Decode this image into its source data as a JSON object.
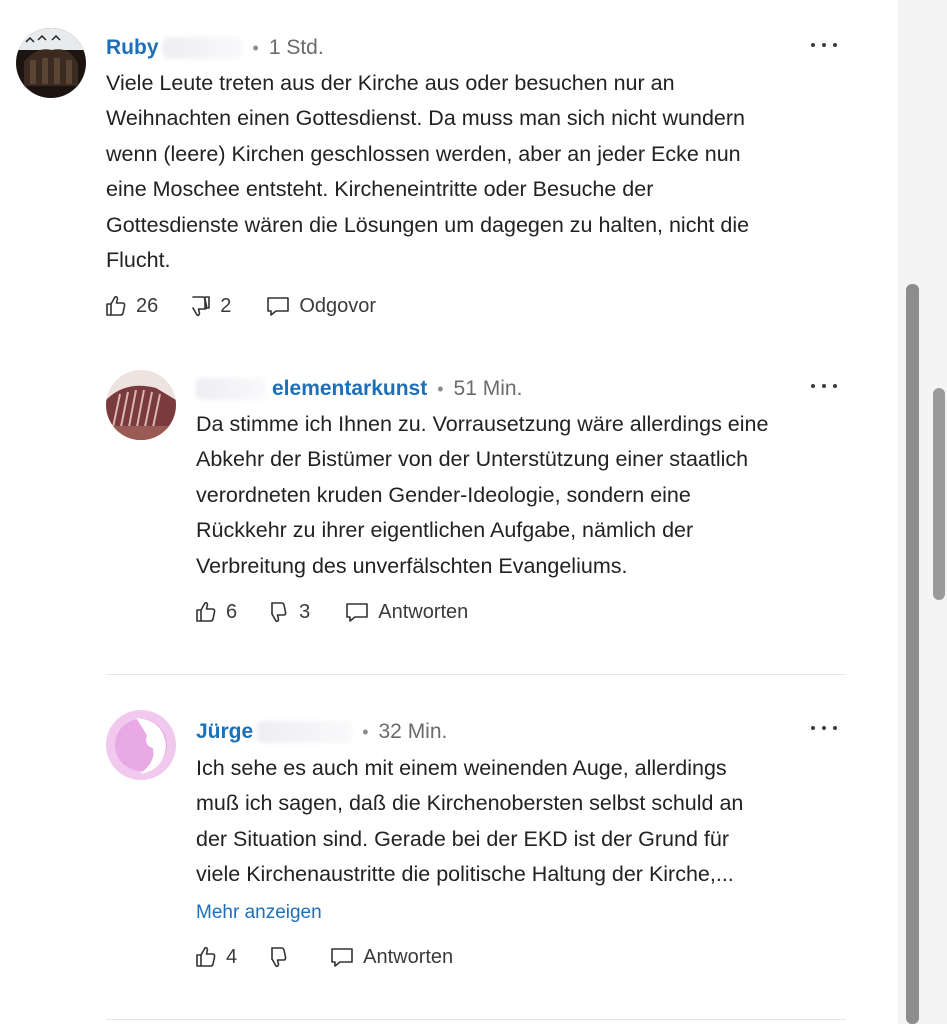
{
  "comments": [
    {
      "author": "Ruby",
      "time": "1 Std.",
      "text": "Viele Leute treten aus der Kirche aus oder besuchen nur an\nWeihnachten einen Gottesdienst. Da muss man sich nicht wundern\nwenn (leere) Kirchen geschlossen werden, aber an jeder Ecke nun\neine Moschee entsteht. Kircheneintritte oder Besuche der\nGottesdienste wären die Lösungen um dagegen zu halten, nicht die\nFlucht.",
      "likes": "26",
      "dislikes": "2",
      "reply_label": "Odgovor"
    },
    {
      "author": "elementarkunst",
      "time": "51 Min.",
      "text": "Da stimme ich Ihnen zu. Vorrausetzung wäre allerdings eine\nAbkehr der Bistümer von der Unterstützung einer staatlich\nverordneten kruden Gender-Ideologie, sondern eine\nRückkehr zu ihrer eigentlichen Aufgabe, nämlich der\nVerbreitung des unverfälschten Evangeliums.",
      "likes": "6",
      "dislikes": "3",
      "reply_label": "Antworten"
    },
    {
      "author": "Jürge",
      "time": "32 Min.",
      "text": "Ich sehe es auch mit einem weinenden Auge, allerdings\nmuß ich sagen, daß die Kirchenobersten selbst schuld an\nder Situation sind. Gerade bei der EKD ist der Grund für\nviele Kirchenaustritte die politische Haltung der Kirche,...",
      "show_more": "Mehr anzeigen",
      "likes": "4",
      "dislikes": "",
      "reply_label": "Antworten"
    }
  ],
  "icons": {
    "like": "thumbs-up-icon",
    "dislike": "thumbs-down-icon",
    "reply": "speech-bubble-icon",
    "more": "more-options-icon"
  },
  "colors": {
    "author": "#1d6fb8",
    "link": "#1d6fb8",
    "scrollbar_thumb": "#8d8d8d"
  }
}
